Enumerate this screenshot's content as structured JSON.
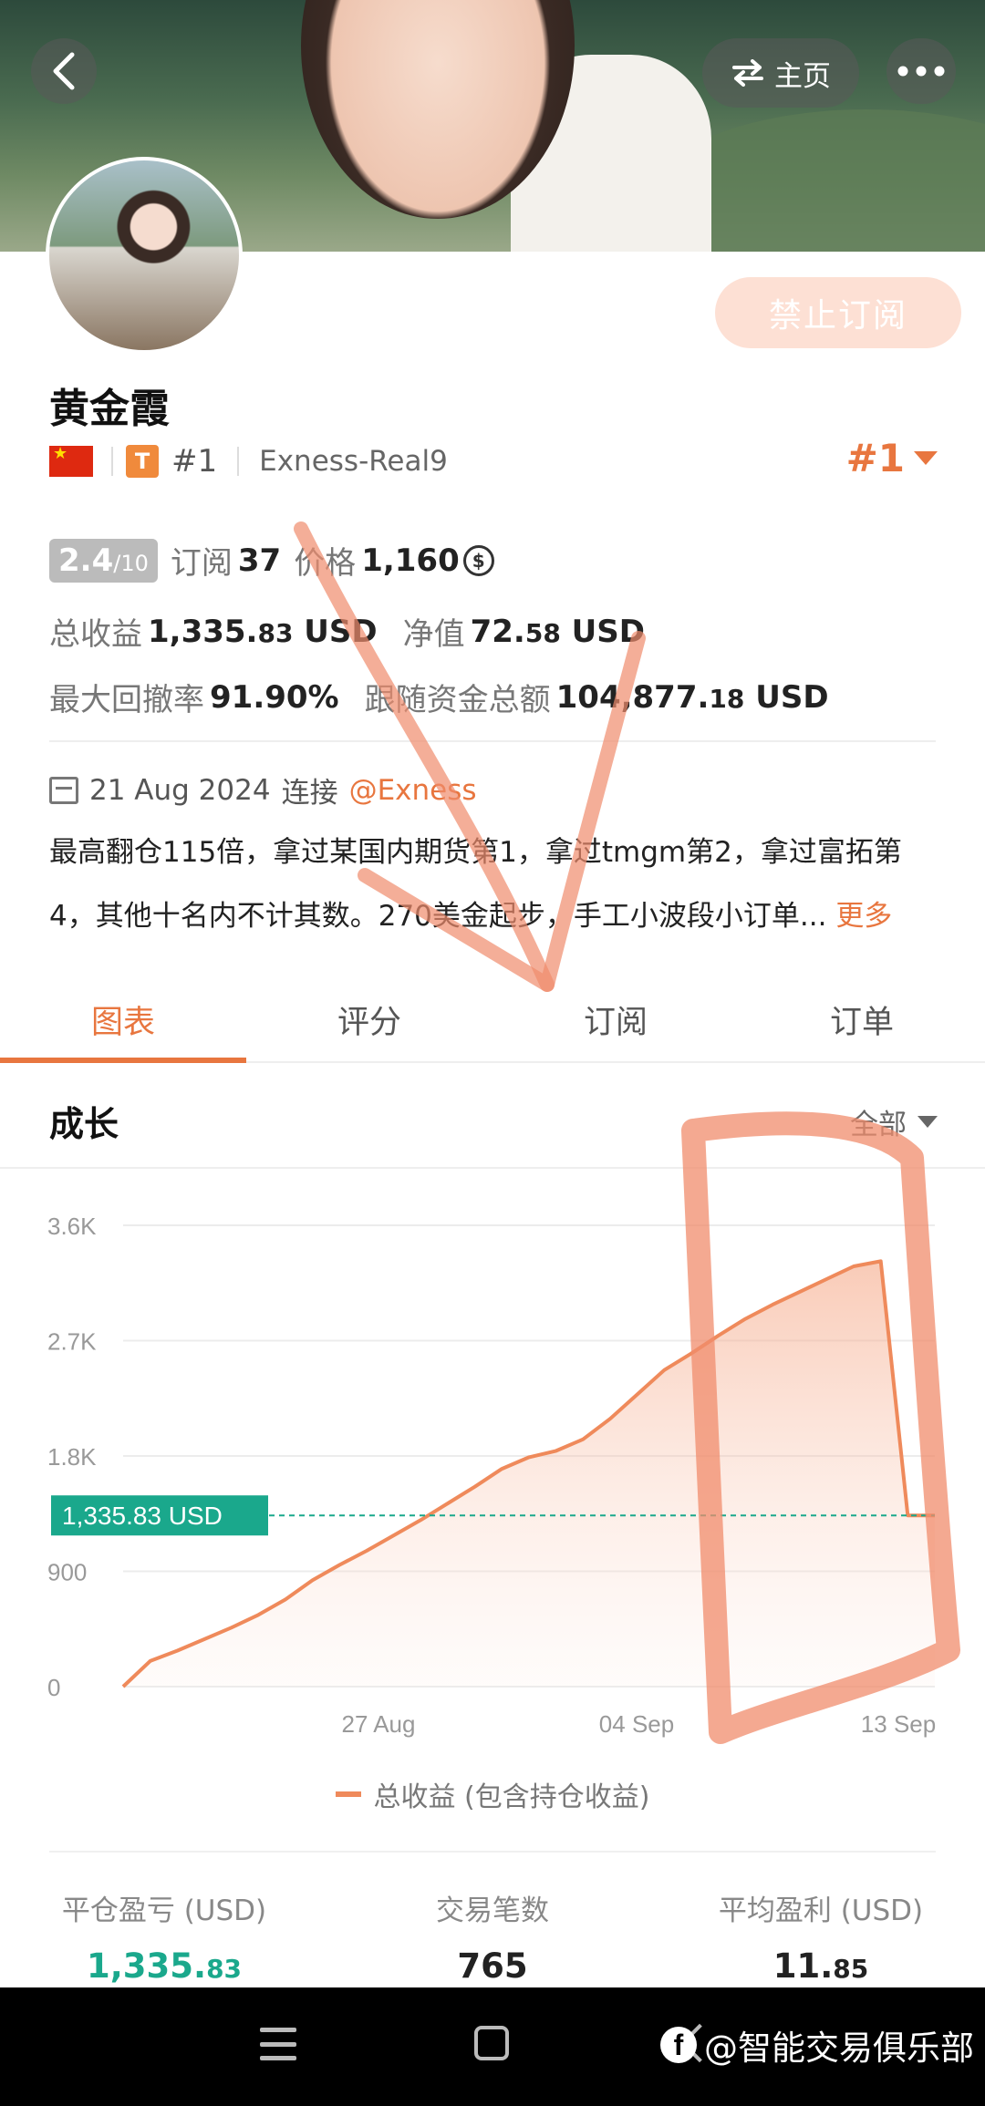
{
  "header": {
    "home_label": "主页"
  },
  "profile": {
    "subscribe_label": "禁止订阅",
    "name": "黄金霞",
    "rank_small": "#1",
    "broker": "Exness-Real9",
    "rank_big": "#1",
    "badge_letter": "T"
  },
  "stats": {
    "score": "2.4",
    "score_max": "/10",
    "subscribe_label": "订阅",
    "subscribe_count": "37",
    "price_label": "价格",
    "price_value": "1,160",
    "total_label": "总收益",
    "total_int": "1,335.",
    "total_dec": "83",
    "total_unit": "USD",
    "equity_label": "净值",
    "equity_int": "72.",
    "equity_dec": "58",
    "equity_unit": "USD",
    "drawdown_label": "最大回撤率",
    "drawdown_value": "91.90%",
    "follow_label": "跟随资金总额",
    "follow_int": "104,877.",
    "follow_dec": "18",
    "follow_unit": "USD"
  },
  "info": {
    "date": "21 Aug 2024",
    "connect_label": "连接",
    "tag": "@Exness",
    "desc_line1": "最高翻仓115倍，拿过某国内期货第1，拿过tmgm第2，拿过富拓第",
    "desc_line2": "4，其他十名内不计其数。270美金起步，手工小波段小订单...",
    "more_label": "更多"
  },
  "tabs": [
    "图表",
    "评分",
    "订阅",
    "订单"
  ],
  "growth": {
    "title": "成长",
    "range_label": "全部"
  },
  "chart_data": {
    "type": "area",
    "series": [
      {
        "name": "总收益 (包含持仓收益)",
        "values": [
          0,
          200,
          280,
          370,
          460,
          560,
          680,
          830,
          950,
          1060,
          1180,
          1300,
          1430,
          1560,
          1700,
          1790,
          1840,
          1930,
          2090,
          2280,
          2470,
          2600,
          2740,
          2870,
          2980,
          3080,
          3180,
          3280,
          3320,
          1335.83,
          1335.83
        ]
      }
    ],
    "xticks": [
      "27 Aug",
      "04 Sep",
      "13 Sep"
    ],
    "yticks": [
      "3.6K",
      "2.7K",
      "1.8K",
      "900",
      "0"
    ],
    "ylim": [
      0,
      3600
    ],
    "current_value": 1335.83,
    "current_label": "1,335.83 USD",
    "grid": true,
    "legend": "bottom"
  },
  "summary": [
    {
      "label": "平仓盈亏 (USD)",
      "int": "1,335.",
      "dec": "83",
      "color": "#1aa88c"
    },
    {
      "label": "交易笔数",
      "int": "765",
      "dec": "",
      "color": "#222222"
    },
    {
      "label": "平均盈利 (USD)",
      "int": "11.",
      "dec": "85",
      "color": "#222222"
    }
  ],
  "watermark": "@智能交易俱乐部",
  "colors": {
    "accent": "#e8763f",
    "green": "#1aa88c",
    "annotation": "#f08c6c"
  }
}
